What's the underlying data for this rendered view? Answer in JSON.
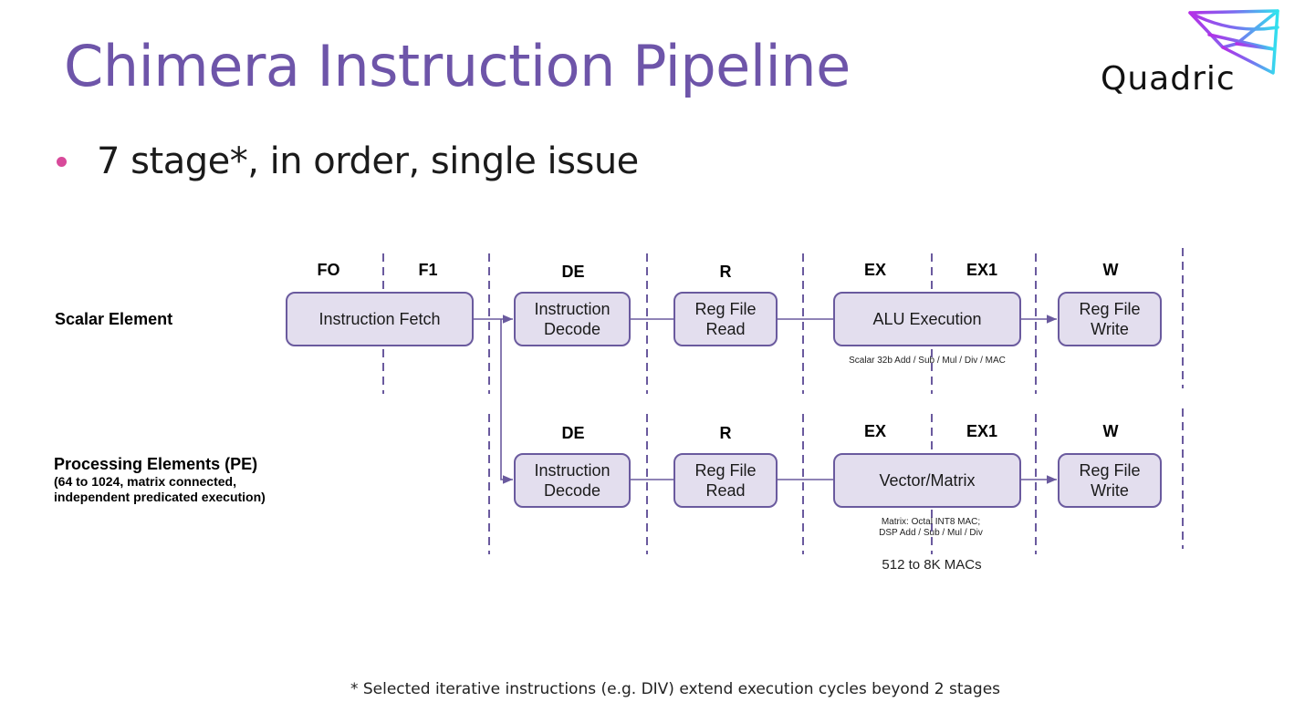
{
  "slide": {
    "title": "Chimera Instruction Pipeline",
    "bullet": "7 stage*, in order, single issue",
    "footnote": "* Selected iterative instructions (e.g. DIV) extend execution cycles beyond 2 stages",
    "colors": {
      "title": "#6e55a9",
      "bullet": "#d84a9a",
      "box_fill": "#e3deee",
      "box_border": "#6a5a9e",
      "divider": "#6a5a9e"
    }
  },
  "logo": {
    "name": "Quadric",
    "icon": "quadric-wing-logo-icon"
  },
  "diagram": {
    "scalar_row": {
      "label": "Scalar Element",
      "stages": [
        "FO",
        "F1",
        "DE",
        "R",
        "EX",
        "EX1",
        "W"
      ],
      "boxes": [
        {
          "id": "instruction-fetch",
          "lines": [
            "Instruction Fetch"
          ]
        },
        {
          "id": "instruction-decode",
          "lines": [
            "Instruction",
            "Decode"
          ]
        },
        {
          "id": "reg-file-read",
          "lines": [
            "Reg File",
            "Read"
          ]
        },
        {
          "id": "alu-execution",
          "lines": [
            "ALU Execution"
          ]
        },
        {
          "id": "reg-file-write",
          "lines": [
            "Reg File",
            "Write"
          ]
        }
      ],
      "note": "Scalar 32b Add / Sub / Mul / Div / MAC"
    },
    "pe_row": {
      "label": "Processing Elements (PE)",
      "sublabel_1": "(64 to 1024, matrix connected,",
      "sublabel_2": "independent predicated execution)",
      "stages": [
        "DE",
        "R",
        "EX",
        "EX1",
        "W"
      ],
      "boxes": [
        {
          "id": "instruction-decode",
          "lines": [
            "Instruction",
            "Decode"
          ]
        },
        {
          "id": "reg-file-read",
          "lines": [
            "Reg File",
            "Read"
          ]
        },
        {
          "id": "vector-matrix",
          "lines": [
            "Vector/Matrix"
          ]
        },
        {
          "id": "reg-file-write",
          "lines": [
            "Reg File",
            "Write"
          ]
        }
      ],
      "note_1": "Matrix: Octal INT8 MAC;",
      "note_2": "DSP Add / Sub / Mul / Div",
      "macs": "512 to 8K MACs"
    }
  }
}
